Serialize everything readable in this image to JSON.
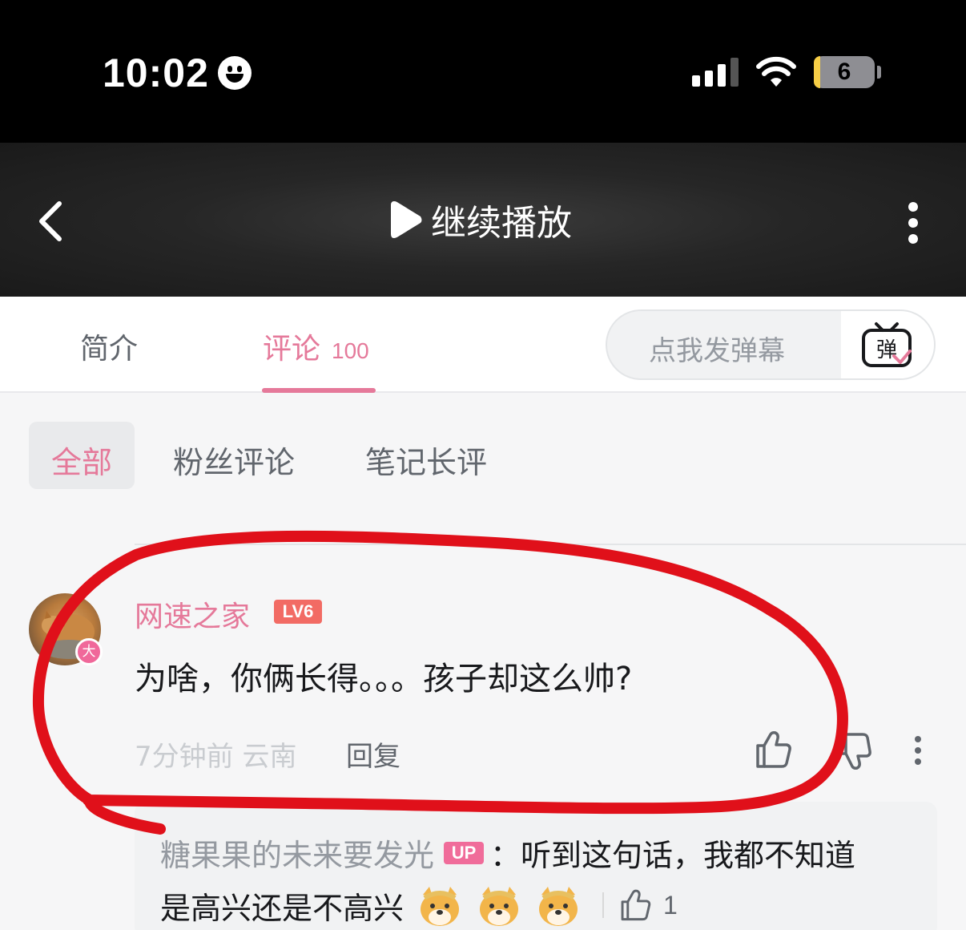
{
  "status_bar": {
    "time": "10:02",
    "battery": "6"
  },
  "header": {
    "continue_label": "继续播放"
  },
  "tabs": {
    "intro": "简介",
    "comments": "评论",
    "comments_count": "100"
  },
  "danmaku": {
    "placeholder": "点我发弹幕",
    "icon_text": "弹"
  },
  "filters": {
    "all": "全部",
    "fans": "粉丝评论",
    "notes": "笔记长评"
  },
  "comment": {
    "username": "网速之家",
    "level": "LV6",
    "avatar_badge": "大",
    "text": "为啥，你俩长得。。。孩子却这么帅?",
    "time_location": "7分钟前 云南",
    "reply_label": "回复",
    "reply": {
      "author": "糖果果的未来要发光",
      "badge": "UP",
      "colon": "：",
      "text_line1": "听到这句话，我都不知道",
      "text_line2": "是高兴还是不高兴",
      "like_count": "1"
    }
  },
  "colors": {
    "accent_pink": "#e5799a",
    "annotation_red": "#e0101a",
    "level_badge": "#f26b64"
  }
}
